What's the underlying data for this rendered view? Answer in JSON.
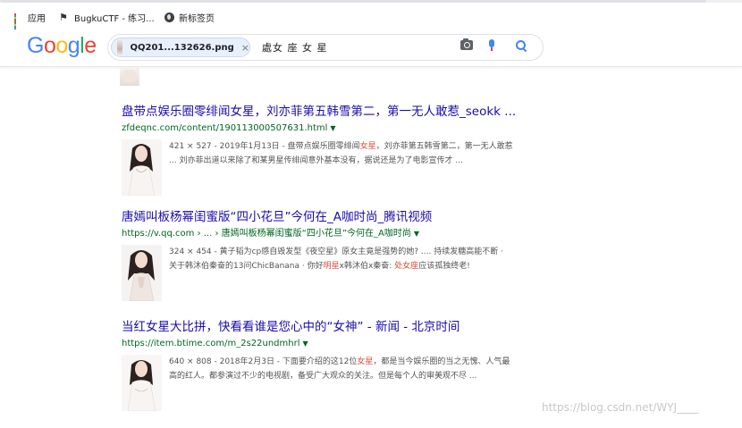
{
  "bookmarks": [
    {
      "label": "应用",
      "icon": "apps-icon"
    },
    {
      "label": "BugkuCTF - 练习...",
      "icon": "flag-icon"
    },
    {
      "label": "新标签页",
      "icon": "globe-icon"
    }
  ],
  "search": {
    "logo": [
      "G",
      "o",
      "o",
      "g",
      "l",
      "e"
    ],
    "logo_colors": [
      "#4285f4",
      "#ea4335",
      "#fbbc05",
      "#4285f4",
      "#34a853",
      "#ea4335"
    ],
    "image_chip": "QQ201...132626.png",
    "chip_close": "×",
    "query": "處女 座 女 星"
  },
  "results": [
    {
      "title": "盘带点娱乐圈零绯闻女星，刘亦菲第五韩雪第二，第一无人敢惹_seokk ...",
      "url": "zfdeqnc.com/content/190113000507631.html",
      "caret": "▼",
      "snippet_lines": [
        [
          {
            "t": "421 × 527 - 2019年1月13日 - 盘带点娱乐圈零绯闻"
          },
          {
            "t": "女星",
            "hl": true
          },
          {
            "t": "，刘亦菲第五韩雪第二，第一无人敢惹"
          }
        ],
        [
          {
            "t": "... 刘亦菲出道以来除了和某男星传绯闻意外基本没有，据说还是为了电影宣传才 ..."
          }
        ]
      ]
    },
    {
      "title": "唐嫣叫板杨幂闺蜜版“四小花旦”今何在_A咖时尚_腾讯视频",
      "url": "https://v.qq.com › ... › 唐嫣叫板杨幂闺蜜版“四小花旦”今何在_A咖时尚",
      "caret": "▼",
      "snippet_lines": [
        [
          {
            "t": "324 × 454 - 黄子韬为cp感自毁发型《夜空星》原女主竟是强势的她? .... 持续发糖高能不断 ·"
          }
        ],
        [
          {
            "t": "关于韩沐伯秦奋的13问ChicBanana · 你好"
          },
          {
            "t": "明星",
            "hl": true
          },
          {
            "t": "x韩沐伯x秦奋: "
          },
          {
            "t": "处女座",
            "hl": true
          },
          {
            "t": "应该孤独终老!"
          }
        ]
      ]
    },
    {
      "title": "当红女星大比拼，快看看谁是您心中的“女神” - 新闻 - 北京时间",
      "url": "https://item.btime.com/m_2s22undmhrl",
      "caret": "▼",
      "snippet_lines": [
        [
          {
            "t": "640 × 808 - 2018年2月3日 - 下面要介绍的这12位"
          },
          {
            "t": "女星",
            "hl": true
          },
          {
            "t": "，都是当今娱乐圈的当之无愧、人气最"
          }
        ],
        [
          {
            "t": "高的红人。都参演过不少的电视剧，备受广大观众的关注。但是每个人的审美观不尽 ..."
          }
        ]
      ]
    }
  ],
  "watermark": "https://blog.csdn.net/WYJ____"
}
